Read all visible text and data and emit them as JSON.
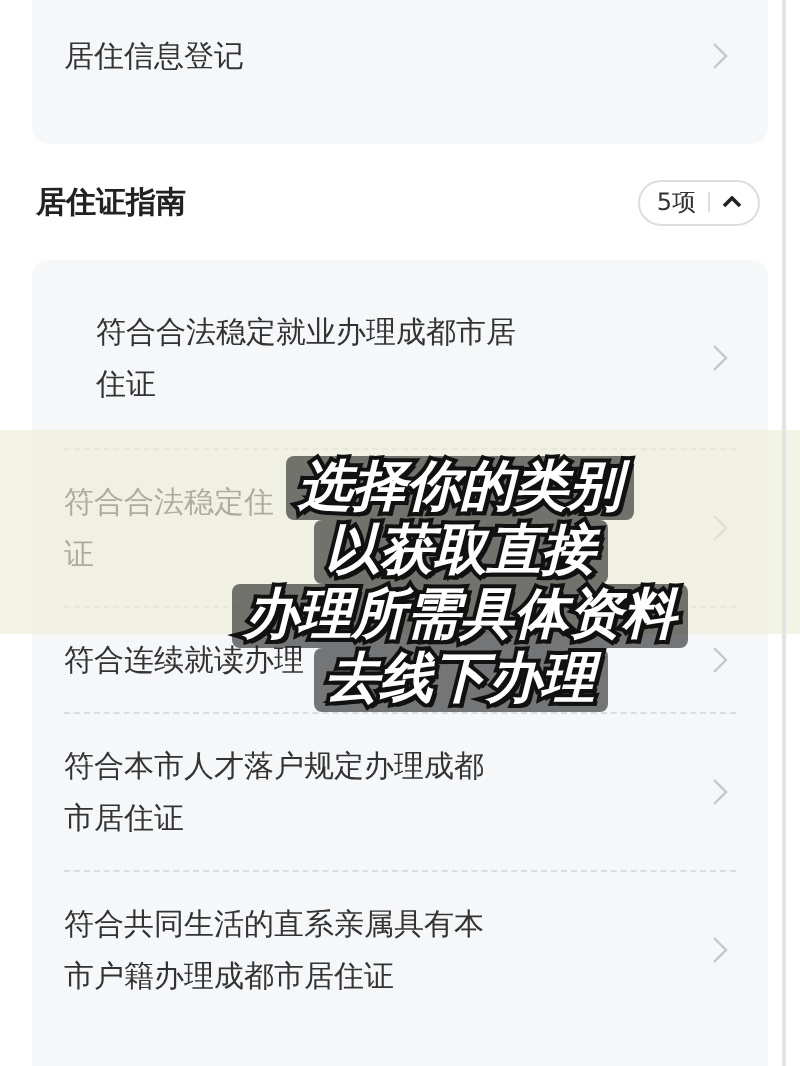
{
  "top_card": {
    "items": [
      {
        "label": "居住信息登记"
      }
    ]
  },
  "section": {
    "title": "居住证指南",
    "count": "5项",
    "expanded": true
  },
  "guide_items": [
    {
      "lines": [
        "符合合法稳定就业办理成都市居",
        "住证"
      ]
    },
    {
      "lines": [
        "符合合法稳定住",
        "证"
      ]
    },
    {
      "lines": [
        "符合连续就读办理"
      ]
    },
    {
      "lines": [
        "符合本市人才落户规定办理成都",
        "市居住证"
      ]
    },
    {
      "lines": [
        "符合共同生活的直系亲属具有本",
        "市户籍办理成都市居住证"
      ]
    }
  ],
  "caption": {
    "lines": [
      "选择你的类别",
      "以获取直接",
      "办理所需具体资料",
      "去线下办理"
    ]
  }
}
